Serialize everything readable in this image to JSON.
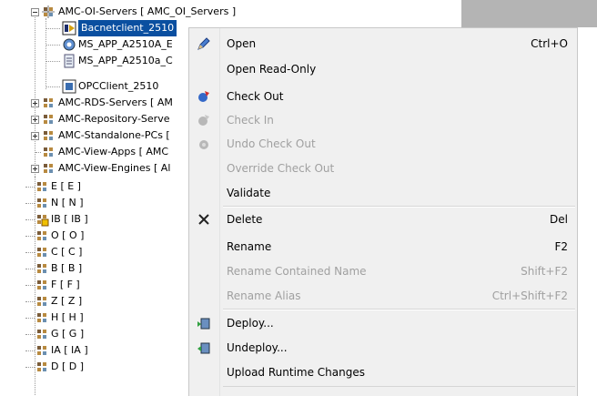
{
  "tree": {
    "items": [
      {
        "label": "AMC-OI-Servers [ AMC_OI_Servers ]"
      },
      {
        "label": "Bacnetclient_2510"
      },
      {
        "label": "MS_APP_A2510A_E"
      },
      {
        "label": "MS_APP_A2510a_C"
      },
      {
        "label": "OPCClient_2510"
      },
      {
        "label": "AMC-RDS-Servers [ AM"
      },
      {
        "label": "AMC-Repository-Serve"
      },
      {
        "label": "AMC-Standalone-PCs ["
      },
      {
        "label": "AMC-View-Apps [ AMC"
      },
      {
        "label": "AMC-View-Engines [ Al"
      },
      {
        "label": "E [ E ]"
      },
      {
        "label": "N [ N ]"
      },
      {
        "label": "IB [ IB ]"
      },
      {
        "label": "O [ O ]"
      },
      {
        "label": "C [ C ]"
      },
      {
        "label": "B [ B ]"
      },
      {
        "label": "F [ F ]"
      },
      {
        "label": "Z [ Z ]"
      },
      {
        "label": "H [ H ]"
      },
      {
        "label": "G [ G ]"
      },
      {
        "label": "IA [ IA ]"
      },
      {
        "label": "D [ D ]"
      }
    ]
  },
  "menu": {
    "items": [
      {
        "label": "Open",
        "shortcut": "Ctrl+O",
        "icon": "pencil-icon",
        "enabled": true
      },
      {
        "label": "Open Read-Only",
        "shortcut": "",
        "enabled": true
      },
      {
        "label": "Check Out",
        "shortcut": "",
        "icon": "check-out-icon",
        "enabled": true
      },
      {
        "label": "Check In",
        "shortcut": "",
        "icon": "check-in-icon",
        "enabled": false
      },
      {
        "label": "Undo Check Out",
        "shortcut": "",
        "icon": "undo-check-out-icon",
        "enabled": false
      },
      {
        "label": "Override Check Out",
        "shortcut": "",
        "enabled": false
      },
      {
        "label": "Validate",
        "shortcut": "",
        "enabled": true
      },
      {
        "label": "Delete",
        "shortcut": "Del",
        "icon": "delete-x-icon",
        "enabled": true
      },
      {
        "label": "Rename",
        "shortcut": "F2",
        "enabled": true
      },
      {
        "label": "Rename Contained Name",
        "shortcut": "Shift+F2",
        "enabled": false
      },
      {
        "label": "Rename Alias",
        "shortcut": "Ctrl+Shift+F2",
        "enabled": false
      },
      {
        "label": "Deploy...",
        "shortcut": "",
        "icon": "deploy-icon",
        "enabled": true
      },
      {
        "label": "Undeploy...",
        "shortcut": "",
        "icon": "undeploy-icon",
        "enabled": true
      },
      {
        "label": "Upload Runtime Changes",
        "shortcut": "",
        "enabled": true
      }
    ]
  },
  "colors": {
    "selection": "#0a4fa0",
    "menu_bg": "#f0f0f0",
    "disabled_text": "#a0a0a0"
  }
}
